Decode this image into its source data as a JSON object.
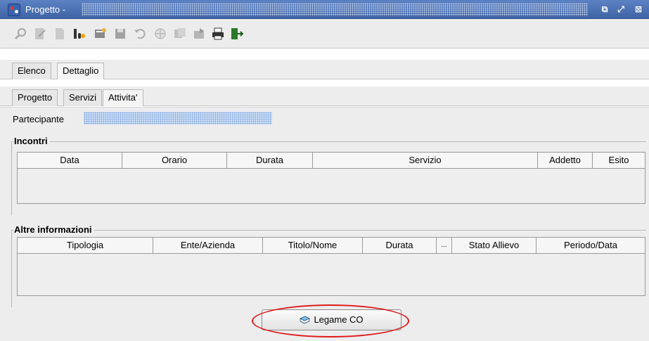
{
  "window": {
    "title": "Progetto -",
    "buttons": {
      "restore": "⧉",
      "maximize": "⤢",
      "close": "⊠"
    }
  },
  "toolbar": {
    "icons": [
      "search-icon",
      "edit-icon",
      "new-document-icon",
      "binoculars-icon",
      "properties-icon",
      "save-icon",
      "undo-icon",
      "globe-icon",
      "copy-icon",
      "export-icon",
      "print-icon",
      "exit-icon"
    ]
  },
  "main_tabs": [
    {
      "label": "Elenco",
      "active": false
    },
    {
      "label": "Dettaglio",
      "active": true
    }
  ],
  "sub_tabs": [
    {
      "label": "Progetto",
      "active": false
    },
    {
      "label": "Servizi",
      "active": false
    },
    {
      "label": "Attivita'",
      "active": true
    }
  ],
  "participant": {
    "label": "Partecipante"
  },
  "incontri": {
    "title": "Incontri",
    "columns": [
      "Data",
      "Orario",
      "Durata",
      "Servizio",
      "Addetto",
      "Esito"
    ],
    "rows": []
  },
  "altre": {
    "title": "Altre informazioni",
    "columns": [
      "Tipologia",
      "Ente/Azienda",
      "Titolo/Nome",
      "Durata",
      "...",
      "Stato Allievo",
      "Periodo/Data"
    ],
    "rows": []
  },
  "legame_button": {
    "label": "Legame CO",
    "icon": "book-icon"
  },
  "colors": {
    "title_bar": "#4a6fae",
    "highlight": "#e01a1a",
    "panel": "#ededed"
  }
}
